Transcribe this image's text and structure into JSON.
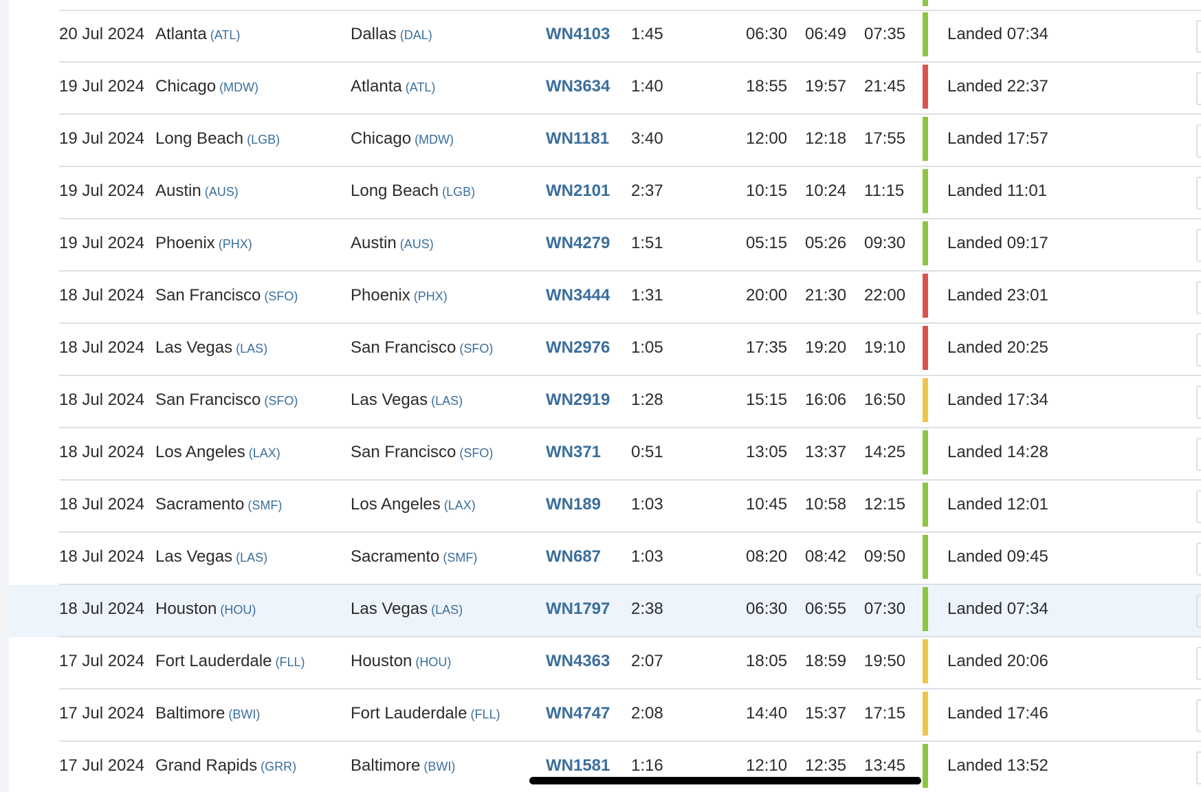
{
  "colors": {
    "accent_link": "#3a6e9c",
    "status_on_time": "#8cc63e",
    "status_late": "#d9534f",
    "status_slight_delay": "#f0c64a",
    "row_highlight": "#eef4fb"
  },
  "flights": [
    {
      "date": "20 Jul 2024",
      "from_city": "Atlanta",
      "from_code": "(ATL)",
      "to_city": "Dallas",
      "to_code": "(DAL)",
      "flight": "WN4103",
      "duration": "1:45",
      "std": "06:30",
      "atd": "06:49",
      "sta": "07:35",
      "status": "Landed 07:34",
      "status_color": "green",
      "highlighted": false
    },
    {
      "date": "19 Jul 2024",
      "from_city": "Chicago",
      "from_code": "(MDW)",
      "to_city": "Atlanta",
      "to_code": "(ATL)",
      "flight": "WN3634",
      "duration": "1:40",
      "std": "18:55",
      "atd": "19:57",
      "sta": "21:45",
      "status": "Landed 22:37",
      "status_color": "red",
      "highlighted": false
    },
    {
      "date": "19 Jul 2024",
      "from_city": "Long Beach",
      "from_code": "(LGB)",
      "to_city": "Chicago",
      "to_code": "(MDW)",
      "flight": "WN1181",
      "duration": "3:40",
      "std": "12:00",
      "atd": "12:18",
      "sta": "17:55",
      "status": "Landed 17:57",
      "status_color": "green",
      "highlighted": false
    },
    {
      "date": "19 Jul 2024",
      "from_city": "Austin",
      "from_code": "(AUS)",
      "to_city": "Long Beach",
      "to_code": "(LGB)",
      "flight": "WN2101",
      "duration": "2:37",
      "std": "10:15",
      "atd": "10:24",
      "sta": "11:15",
      "status": "Landed 11:01",
      "status_color": "green",
      "highlighted": false
    },
    {
      "date": "19 Jul 2024",
      "from_city": "Phoenix",
      "from_code": "(PHX)",
      "to_city": "Austin",
      "to_code": "(AUS)",
      "flight": "WN4279",
      "duration": "1:51",
      "std": "05:15",
      "atd": "05:26",
      "sta": "09:30",
      "status": "Landed 09:17",
      "status_color": "green",
      "highlighted": false
    },
    {
      "date": "18 Jul 2024",
      "from_city": "San Francisco",
      "from_code": "(SFO)",
      "to_city": "Phoenix",
      "to_code": "(PHX)",
      "flight": "WN3444",
      "duration": "1:31",
      "std": "20:00",
      "atd": "21:30",
      "sta": "22:00",
      "status": "Landed 23:01",
      "status_color": "red",
      "highlighted": false
    },
    {
      "date": "18 Jul 2024",
      "from_city": "Las Vegas",
      "from_code": "(LAS)",
      "to_city": "San Francisco",
      "to_code": "(SFO)",
      "flight": "WN2976",
      "duration": "1:05",
      "std": "17:35",
      "atd": "19:20",
      "sta": "19:10",
      "status": "Landed 20:25",
      "status_color": "red",
      "highlighted": false
    },
    {
      "date": "18 Jul 2024",
      "from_city": "San Francisco",
      "from_code": "(SFO)",
      "to_city": "Las Vegas",
      "to_code": "(LAS)",
      "flight": "WN2919",
      "duration": "1:28",
      "std": "15:15",
      "atd": "16:06",
      "sta": "16:50",
      "status": "Landed 17:34",
      "status_color": "yellow",
      "highlighted": false
    },
    {
      "date": "18 Jul 2024",
      "from_city": "Los Angeles",
      "from_code": "(LAX)",
      "to_city": "San Francisco",
      "to_code": "(SFO)",
      "flight": "WN371",
      "duration": "0:51",
      "std": "13:05",
      "atd": "13:37",
      "sta": "14:25",
      "status": "Landed 14:28",
      "status_color": "green",
      "highlighted": false
    },
    {
      "date": "18 Jul 2024",
      "from_city": "Sacramento",
      "from_code": "(SMF)",
      "to_city": "Los Angeles",
      "to_code": "(LAX)",
      "flight": "WN189",
      "duration": "1:03",
      "std": "10:45",
      "atd": "10:58",
      "sta": "12:15",
      "status": "Landed 12:01",
      "status_color": "green",
      "highlighted": false
    },
    {
      "date": "18 Jul 2024",
      "from_city": "Las Vegas",
      "from_code": "(LAS)",
      "to_city": "Sacramento",
      "to_code": "(SMF)",
      "flight": "WN687",
      "duration": "1:03",
      "std": "08:20",
      "atd": "08:42",
      "sta": "09:50",
      "status": "Landed 09:45",
      "status_color": "green",
      "highlighted": false
    },
    {
      "date": "18 Jul 2024",
      "from_city": "Houston",
      "from_code": "(HOU)",
      "to_city": "Las Vegas",
      "to_code": "(LAS)",
      "flight": "WN1797",
      "duration": "2:38",
      "std": "06:30",
      "atd": "06:55",
      "sta": "07:30",
      "status": "Landed 07:34",
      "status_color": "green",
      "highlighted": true
    },
    {
      "date": "17 Jul 2024",
      "from_city": "Fort Lauderdale",
      "from_code": "(FLL)",
      "to_city": "Houston",
      "to_code": "(HOU)",
      "flight": "WN4363",
      "duration": "2:07",
      "std": "18:05",
      "atd": "18:59",
      "sta": "19:50",
      "status": "Landed 20:06",
      "status_color": "yellow",
      "highlighted": false
    },
    {
      "date": "17 Jul 2024",
      "from_city": "Baltimore",
      "from_code": "(BWI)",
      "to_city": "Fort Lauderdale",
      "to_code": "(FLL)",
      "flight": "WN4747",
      "duration": "2:08",
      "std": "14:40",
      "atd": "15:37",
      "sta": "17:15",
      "status": "Landed 17:46",
      "status_color": "yellow",
      "highlighted": false
    },
    {
      "date": "17 Jul 2024",
      "from_city": "Grand Rapids",
      "from_code": "(GRR)",
      "to_city": "Baltimore",
      "to_code": "(BWI)",
      "flight": "WN1581",
      "duration": "1:16",
      "std": "12:10",
      "atd": "12:35",
      "sta": "13:45",
      "status": "Landed 13:52",
      "status_color": "green",
      "highlighted": false
    }
  ]
}
